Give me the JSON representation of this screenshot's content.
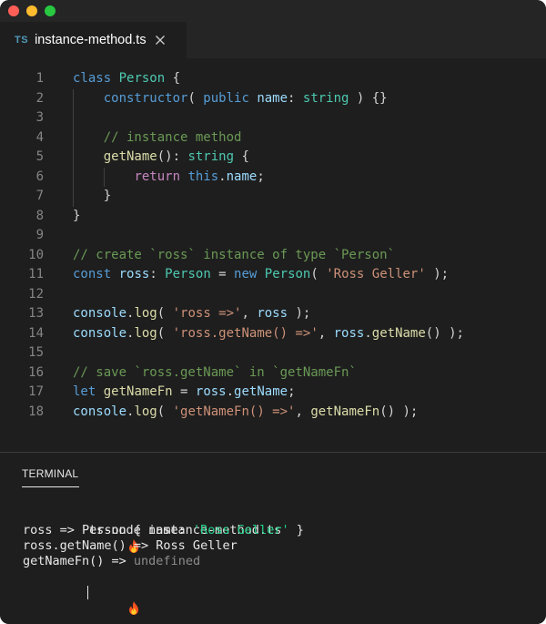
{
  "window": {
    "tab_lang": "TS",
    "tab_filename": "instance-method.ts"
  },
  "editor": {
    "lines": [
      {
        "num": "1",
        "tokens": [
          [
            "kw",
            "class"
          ],
          [
            "plain",
            " "
          ],
          [
            "type",
            "Person"
          ],
          [
            "plain",
            " {"
          ]
        ]
      },
      {
        "num": "2",
        "tokens": [
          [
            "plain",
            "    "
          ],
          [
            "kw",
            "constructor"
          ],
          [
            "plain",
            "( "
          ],
          [
            "kw",
            "public"
          ],
          [
            "plain",
            " "
          ],
          [
            "var",
            "name"
          ],
          [
            "plain",
            ": "
          ],
          [
            "type",
            "string"
          ],
          [
            "plain",
            " ) {}"
          ]
        ]
      },
      {
        "num": "3",
        "tokens": []
      },
      {
        "num": "4",
        "tokens": [
          [
            "plain",
            "    "
          ],
          [
            "com",
            "// instance method"
          ]
        ]
      },
      {
        "num": "5",
        "tokens": [
          [
            "plain",
            "    "
          ],
          [
            "fn",
            "getName"
          ],
          [
            "plain",
            "(): "
          ],
          [
            "type",
            "string"
          ],
          [
            "plain",
            " {"
          ]
        ]
      },
      {
        "num": "6",
        "tokens": [
          [
            "plain",
            "        "
          ],
          [
            "ctrl",
            "return"
          ],
          [
            "plain",
            " "
          ],
          [
            "kw",
            "this"
          ],
          [
            "plain",
            "."
          ],
          [
            "var",
            "name"
          ],
          [
            "plain",
            ";"
          ]
        ]
      },
      {
        "num": "7",
        "tokens": [
          [
            "plain",
            "    }"
          ]
        ]
      },
      {
        "num": "8",
        "tokens": [
          [
            "plain",
            "}"
          ]
        ]
      },
      {
        "num": "9",
        "tokens": []
      },
      {
        "num": "10",
        "tokens": [
          [
            "com",
            "// create `ross` instance of type `Person`"
          ]
        ]
      },
      {
        "num": "11",
        "tokens": [
          [
            "kw",
            "const"
          ],
          [
            "plain",
            " "
          ],
          [
            "var",
            "ross"
          ],
          [
            "plain",
            ": "
          ],
          [
            "type",
            "Person"
          ],
          [
            "plain",
            " = "
          ],
          [
            "kw",
            "new"
          ],
          [
            "plain",
            " "
          ],
          [
            "type",
            "Person"
          ],
          [
            "plain",
            "( "
          ],
          [
            "str",
            "'Ross Geller'"
          ],
          [
            "plain",
            " );"
          ]
        ]
      },
      {
        "num": "12",
        "tokens": []
      },
      {
        "num": "13",
        "tokens": [
          [
            "var",
            "console"
          ],
          [
            "plain",
            "."
          ],
          [
            "fn",
            "log"
          ],
          [
            "plain",
            "( "
          ],
          [
            "str",
            "'ross =>'"
          ],
          [
            "plain",
            ", "
          ],
          [
            "var",
            "ross"
          ],
          [
            "plain",
            " );"
          ]
        ]
      },
      {
        "num": "14",
        "tokens": [
          [
            "var",
            "console"
          ],
          [
            "plain",
            "."
          ],
          [
            "fn",
            "log"
          ],
          [
            "plain",
            "( "
          ],
          [
            "str",
            "'ross.getName() =>'"
          ],
          [
            "plain",
            ", "
          ],
          [
            "var",
            "ross"
          ],
          [
            "plain",
            "."
          ],
          [
            "fn",
            "getName"
          ],
          [
            "plain",
            "() );"
          ]
        ]
      },
      {
        "num": "15",
        "tokens": []
      },
      {
        "num": "16",
        "tokens": [
          [
            "com",
            "// save `ross.getName` in `getNameFn`"
          ]
        ]
      },
      {
        "num": "17",
        "tokens": [
          [
            "kw",
            "let"
          ],
          [
            "plain",
            " "
          ],
          [
            "fn",
            "getNameFn"
          ],
          [
            "plain",
            " = "
          ],
          [
            "var",
            "ross"
          ],
          [
            "plain",
            "."
          ],
          [
            "var",
            "getName"
          ],
          [
            "plain",
            ";"
          ]
        ]
      },
      {
        "num": "18",
        "tokens": [
          [
            "var",
            "console"
          ],
          [
            "plain",
            "."
          ],
          [
            "fn",
            "log"
          ],
          [
            "plain",
            "( "
          ],
          [
            "str",
            "'getNameFn() =>'"
          ],
          [
            "plain",
            ", "
          ],
          [
            "fn",
            "getNameFn"
          ],
          [
            "plain",
            "() );"
          ]
        ]
      }
    ]
  },
  "terminal": {
    "tab_label": "TERMINAL",
    "command": " ts-node instance-method.ts",
    "out1_prefix": "ross => Person { name: ",
    "out1_string": "'Ross Geller'",
    "out1_suffix": " }",
    "out2": "ross.getName() => Ross Geller",
    "out3_prefix": "getNameFn() => ",
    "out3_value": "undefined",
    "prompt_icon": "fire-icon"
  },
  "colors": {
    "keyword": "#569cd6",
    "control": "#c586c0",
    "type": "#4ec9b0",
    "variable": "#9cdcfe",
    "function": "#dcdcaa",
    "string": "#ce9178",
    "comment": "#6a9955",
    "terminal_string": "#23d18b"
  }
}
